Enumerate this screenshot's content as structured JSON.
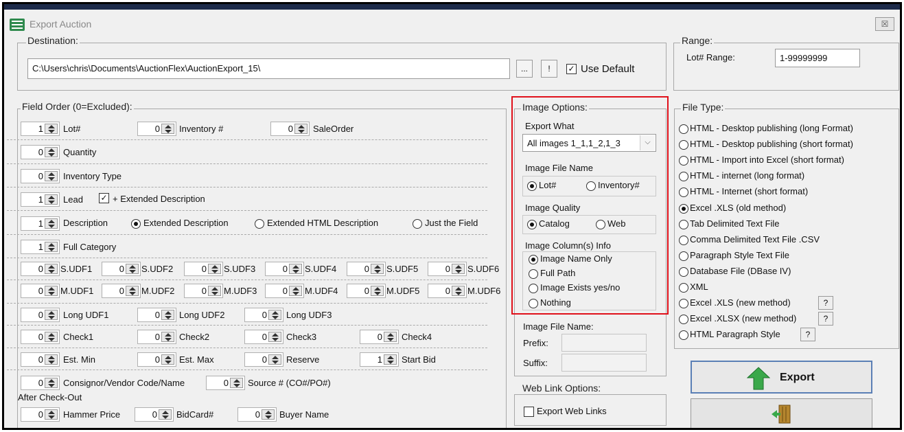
{
  "window": {
    "title": "Export Auction",
    "close_label": "☒"
  },
  "destination": {
    "label": "Destination:",
    "path": "C:\\Users\\chris\\Documents\\AuctionFlex\\AuctionExport_15\\",
    "browse_label": "...",
    "bang_label": "!",
    "use_default_label": "Use Default",
    "use_default_checked": true
  },
  "range": {
    "label": "Range:",
    "lot_range_label": "Lot# Range:",
    "lot_range_value": "1-99999999"
  },
  "field_order": {
    "label": "Field Order (0=Excluded):",
    "lot": {
      "value": "1",
      "label": "Lot#"
    },
    "inventory_no": {
      "value": "0",
      "label": "Inventory #"
    },
    "sale_order": {
      "value": "0",
      "label": "SaleOrder"
    },
    "quantity": {
      "value": "0",
      "label": "Quantity"
    },
    "inventory_type": {
      "value": "0",
      "label": "Inventory Type"
    },
    "lead": {
      "value": "1",
      "label": "Lead"
    },
    "extended_description_check": {
      "label": "+ Extended Description",
      "checked": true
    },
    "description": {
      "value": "1",
      "label": "Description"
    },
    "description_options": [
      {
        "label": "Extended Description",
        "selected": true
      },
      {
        "label": "Extended HTML Description",
        "selected": false
      },
      {
        "label": "Just the Field",
        "selected": false
      }
    ],
    "full_category": {
      "value": "1",
      "label": "Full Category"
    },
    "s_udfs": [
      {
        "value": "0",
        "label": "S.UDF1"
      },
      {
        "value": "0",
        "label": "S.UDF2"
      },
      {
        "value": "0",
        "label": "S.UDF3"
      },
      {
        "value": "0",
        "label": "S.UDF4"
      },
      {
        "value": "0",
        "label": "S.UDF5"
      },
      {
        "value": "0",
        "label": "S.UDF6"
      }
    ],
    "m_udfs": [
      {
        "value": "0",
        "label": "M.UDF1"
      },
      {
        "value": "0",
        "label": "M.UDF2"
      },
      {
        "value": "0",
        "label": "M.UDF3"
      },
      {
        "value": "0",
        "label": "M.UDF4"
      },
      {
        "value": "0",
        "label": "M.UDF5"
      },
      {
        "value": "0",
        "label": "M.UDF6"
      }
    ],
    "long_udfs": [
      {
        "value": "0",
        "label": "Long UDF1"
      },
      {
        "value": "0",
        "label": "Long UDF2"
      },
      {
        "value": "0",
        "label": "Long UDF3"
      }
    ],
    "checks": [
      {
        "value": "0",
        "label": "Check1"
      },
      {
        "value": "0",
        "label": "Check2"
      },
      {
        "value": "0",
        "label": "Check3"
      },
      {
        "value": "0",
        "label": "Check4"
      }
    ],
    "estimates": [
      {
        "value": "0",
        "label": "Est. Min"
      },
      {
        "value": "0",
        "label": "Est. Max"
      },
      {
        "value": "0",
        "label": "Reserve"
      },
      {
        "value": "1",
        "label": "Start Bid"
      }
    ],
    "consignor": {
      "value": "0",
      "label": "Consignor/Vendor Code/Name"
    },
    "source": {
      "value": "0",
      "label": "Source # (CO#/PO#)"
    },
    "after_checkout_label": "After Check-Out",
    "after_checkout": [
      {
        "value": "0",
        "label": "Hammer Price"
      },
      {
        "value": "0",
        "label": "BidCard#"
      },
      {
        "value": "0",
        "label": "Buyer Name"
      }
    ]
  },
  "image_options": {
    "label": "Image Options:",
    "export_what_label": "Export What",
    "export_what_value": "All images 1_1,1_2,1_3",
    "file_name_label": "Image File Name",
    "file_name_options": [
      {
        "label": "Lot#",
        "selected": true
      },
      {
        "label": "Inventory#",
        "selected": false
      }
    ],
    "quality_label": "Image Quality",
    "quality_options": [
      {
        "label": "Catalog",
        "selected": true
      },
      {
        "label": "Web",
        "selected": false
      }
    ],
    "columns_label": "Image Column(s) Info",
    "columns_options": [
      {
        "label": "Image Name Only",
        "selected": true
      },
      {
        "label": "Full Path",
        "selected": false
      },
      {
        "label": "Image Exists yes/no",
        "selected": false
      },
      {
        "label": "Nothing",
        "selected": false
      }
    ],
    "file_name_section_label": "Image File Name:",
    "prefix_label": "Prefix:",
    "prefix_value": "",
    "suffix_label": "Suffix:",
    "suffix_value": ""
  },
  "web_link": {
    "label": "Web Link Options:",
    "export_links_label": "Export Web Links",
    "checked": false
  },
  "file_type": {
    "label": "File Type:",
    "options": [
      {
        "label": "HTML - Desktop publishing  (long Format)",
        "selected": false
      },
      {
        "label": "HTML - Desktop publishing (short format)",
        "selected": false
      },
      {
        "label": "HTML - Import into Excel (short format)",
        "selected": false
      },
      {
        "label": "HTML - internet (long format)",
        "selected": false
      },
      {
        "label": "HTML - Internet (short format)",
        "selected": false
      },
      {
        "label": "Excel .XLS (old method)",
        "selected": true
      },
      {
        "label": "Tab Delimited Text File",
        "selected": false
      },
      {
        "label": "Comma Delimited Text File  .CSV",
        "selected": false
      },
      {
        "label": "Paragraph Style Text File",
        "selected": false
      },
      {
        "label": "Database File (DBase IV)",
        "selected": false
      },
      {
        "label": "XML",
        "selected": false
      },
      {
        "label": "Excel .XLS (new method)",
        "selected": false
      },
      {
        "label": "Excel .XLSX (new method)",
        "selected": false
      },
      {
        "label": "HTML Paragraph Style",
        "selected": false
      }
    ],
    "help_label": "?"
  },
  "actions": {
    "export_label": "Export"
  },
  "colors": {
    "highlight_box": "#e0101a",
    "export_arrow": "#3aa84a",
    "exit_door": "#b5862e"
  }
}
